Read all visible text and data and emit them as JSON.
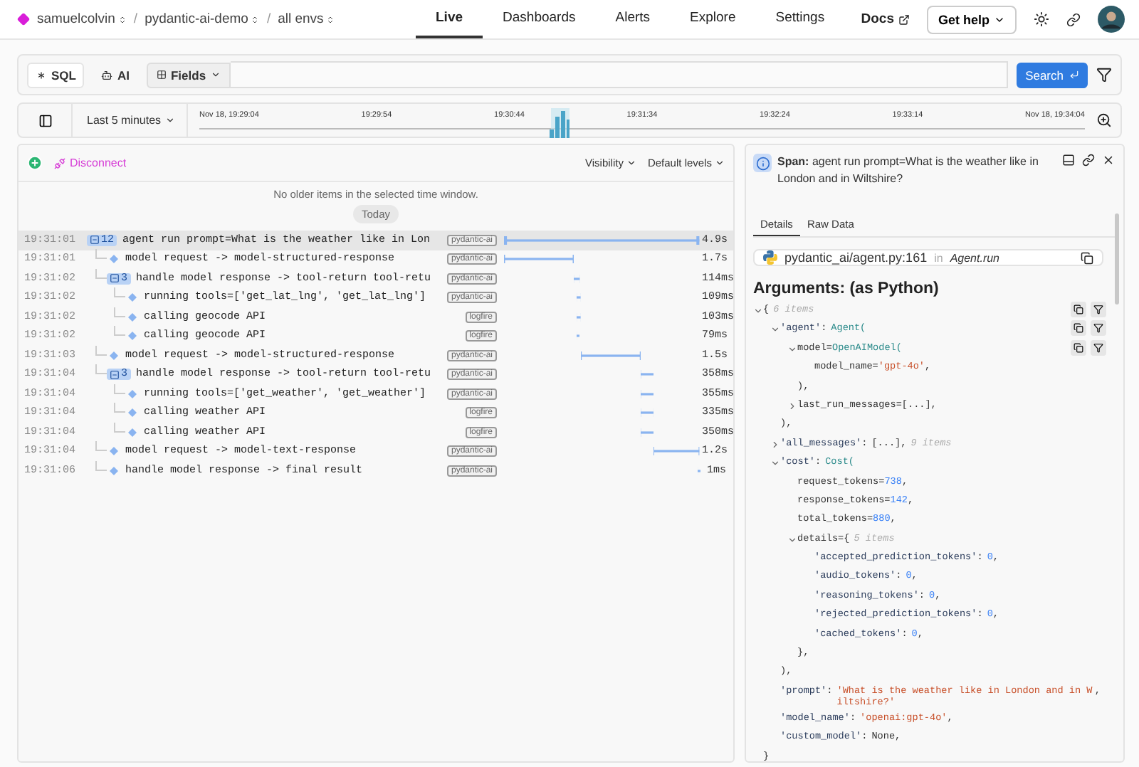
{
  "nav": {
    "breadcrumbs": [
      {
        "label": "samuelcolvin",
        "separator": "/"
      },
      {
        "label": "pydantic-ai-demo",
        "separator": "/"
      },
      {
        "label": "all envs"
      }
    ],
    "tabs": [
      {
        "label": "Live",
        "selected": true
      },
      {
        "label": "Dashboards",
        "selected": false
      },
      {
        "label": "Alerts",
        "selected": false
      },
      {
        "label": "Explore",
        "selected": false
      },
      {
        "label": "Settings",
        "selected": false
      }
    ],
    "docs": "Docs",
    "help": "Get help"
  },
  "query": {
    "modes": [
      {
        "label": "SQL",
        "kind": "sql",
        "selected": true
      },
      {
        "label": "AI",
        "kind": "ai",
        "selected": false
      }
    ],
    "fields": "Fields",
    "search": "Search"
  },
  "timeline": {
    "sidebar_open": false,
    "range": "Last 5 minutes",
    "ticks": [
      "Nov 18, 19:29:04",
      "19:29:54",
      "19:30:44",
      "19:31:34",
      "19:32:24",
      "19:33:14",
      "Nov 18, 19:34:04"
    ]
  },
  "live": {
    "disconnect": "Disconnect",
    "visibility": "Visibility",
    "levels": "Default levels",
    "notice": "No older items in the selected time window.",
    "day": "Today",
    "rows": [
      {
        "time": "19:31:01",
        "name": "agent run prompt=What is the weather like in Lon",
        "tag": "pydantic-ai",
        "duration": "4.9s",
        "count": "12",
        "expanded": true,
        "selected": true,
        "children": [
          {
            "time": "19:31:01",
            "name": "model request -> model-structured-response",
            "tag": "pydantic-ai",
            "duration": "1.7s",
            "selected": false
          },
          {
            "time": "19:31:02",
            "name": "handle model response -> tool-return tool-retu",
            "tag": "pydantic-ai",
            "duration": "114ms",
            "count": "3",
            "expanded": true,
            "selected": false,
            "children": [
              {
                "time": "19:31:02",
                "name": "running tools=['get_lat_lng', 'get_lat_lng']",
                "tag": "pydantic-ai",
                "duration": "109ms",
                "selected": false
              },
              {
                "time": "19:31:02",
                "name": "calling geocode API",
                "tag": "logfire",
                "duration": "103ms",
                "selected": false
              },
              {
                "time": "19:31:02",
                "name": "calling geocode API",
                "tag": "logfire",
                "duration": "79ms",
                "selected": false
              }
            ]
          },
          {
            "time": "19:31:03",
            "name": "model request -> model-structured-response",
            "tag": "pydantic-ai",
            "duration": "1.5s",
            "selected": false
          },
          {
            "time": "19:31:04",
            "name": "handle model response -> tool-return tool-retu",
            "tag": "pydantic-ai",
            "duration": "358ms",
            "count": "3",
            "expanded": true,
            "selected": false,
            "children": [
              {
                "time": "19:31:04",
                "name": "running tools=['get_weather', 'get_weather']",
                "tag": "pydantic-ai",
                "duration": "355ms",
                "selected": false
              },
              {
                "time": "19:31:04",
                "name": "calling weather API",
                "tag": "logfire",
                "duration": "335ms",
                "selected": false
              },
              {
                "time": "19:31:04",
                "name": "calling weather API",
                "tag": "logfire",
                "duration": "350ms",
                "selected": false
              }
            ]
          },
          {
            "time": "19:31:04",
            "name": "model request -> model-text-response",
            "tag": "pydantic-ai",
            "duration": "1.2s",
            "selected": false
          },
          {
            "time": "19:31:06",
            "name": "handle model response -> final result",
            "tag": "pydantic-ai",
            "duration": "1ms",
            "selected": false
          }
        ]
      }
    ]
  },
  "details": {
    "title": "**Span:** agent run prompt=What is the weather like in London and in Wiltshire?",
    "tabs": [
      {
        "label": "Details",
        "selected": true
      },
      {
        "label": "Raw Data",
        "selected": false
      }
    ],
    "source": {
      "path": "pydantic_ai/agent.py:161",
      "in": "in",
      "func": "Agent.run"
    },
    "heading": "Arguments: (as Python)",
    "code": [
      {
        "tokens": [
          {
            "kind": "plain",
            "text": "{"
          },
          {
            "kind": "note",
            "text": "6 items"
          }
        ],
        "expanded": true,
        "actions": true,
        "children": [
          {
            "tokens": [
              {
                "kind": "key",
                "text": "'agent'"
              },
              {
                "kind": "colon",
                "text": ":"
              },
              {
                "kind": "cls",
                "text": "Agent("
              }
            ],
            "expanded": true,
            "actions": true,
            "children": [
              {
                "tokens": [
                  {
                    "kind": "plain",
                    "text": "model="
                  },
                  {
                    "kind": "cls",
                    "text": "OpenAIModel("
                  }
                ],
                "expanded": true,
                "actions": true,
                "children": [
                  {
                    "tokens": [
                      {
                        "kind": "plain",
                        "text": "model_name="
                      },
                      {
                        "kind": "str",
                        "text": "'gpt-4o'"
                      },
                      {
                        "kind": "plain",
                        "text": ","
                      }
                    ]
                  }
                ]
              },
              {
                "tokens": [
                  {
                    "kind": "plain",
                    "text": "),"
                  }
                ]
              },
              {
                "tokens": [
                  {
                    "kind": "plain",
                    "text": "last_run_messages=[...],"
                  }
                ],
                "expanded": false
              }
            ]
          },
          {
            "tokens": [
              {
                "kind": "plain",
                "text": "),"
              }
            ]
          },
          {
            "tokens": [
              {
                "kind": "key",
                "text": "'all_messages'"
              },
              {
                "kind": "colon",
                "text": ":"
              },
              {
                "kind": "plain",
                "text": "[...],"
              },
              {
                "kind": "note",
                "text": "9 items"
              }
            ],
            "expanded": false
          },
          {
            "tokens": [
              {
                "kind": "key",
                "text": "'cost'"
              },
              {
                "kind": "colon",
                "text": ":"
              },
              {
                "kind": "cls",
                "text": "Cost("
              }
            ],
            "expanded": true,
            "children": [
              {
                "tokens": [
                  {
                    "kind": "plain",
                    "text": "request_tokens="
                  },
                  {
                    "kind": "num",
                    "text": "738"
                  },
                  {
                    "kind": "plain",
                    "text": ","
                  }
                ]
              },
              {
                "tokens": [
                  {
                    "kind": "plain",
                    "text": "response_tokens="
                  },
                  {
                    "kind": "num",
                    "text": "142"
                  },
                  {
                    "kind": "plain",
                    "text": ","
                  }
                ]
              },
              {
                "tokens": [
                  {
                    "kind": "plain",
                    "text": "total_tokens="
                  },
                  {
                    "kind": "num",
                    "text": "880"
                  },
                  {
                    "kind": "plain",
                    "text": ","
                  }
                ]
              },
              {
                "tokens": [
                  {
                    "kind": "plain",
                    "text": "details={"
                  },
                  {
                    "kind": "note",
                    "text": "5 items"
                  }
                ],
                "expanded": true,
                "children": [
                  {
                    "tokens": [
                      {
                        "kind": "key",
                        "text": "'accepted_prediction_tokens'"
                      },
                      {
                        "kind": "colon",
                        "text": ":"
                      },
                      {
                        "kind": "num",
                        "text": "0"
                      },
                      {
                        "kind": "plain",
                        "text": ","
                      }
                    ]
                  },
                  {
                    "tokens": [
                      {
                        "kind": "key",
                        "text": "'audio_tokens'"
                      },
                      {
                        "kind": "colon",
                        "text": ":"
                      },
                      {
                        "kind": "num",
                        "text": "0"
                      },
                      {
                        "kind": "plain",
                        "text": ","
                      }
                    ]
                  },
                  {
                    "tokens": [
                      {
                        "kind": "key",
                        "text": "'reasoning_tokens'"
                      },
                      {
                        "kind": "colon",
                        "text": ":"
                      },
                      {
                        "kind": "num",
                        "text": "0"
                      },
                      {
                        "kind": "plain",
                        "text": ","
                      }
                    ]
                  },
                  {
                    "tokens": [
                      {
                        "kind": "key",
                        "text": "'rejected_prediction_tokens'"
                      },
                      {
                        "kind": "colon",
                        "text": ":"
                      },
                      {
                        "kind": "num",
                        "text": "0"
                      },
                      {
                        "kind": "plain",
                        "text": ","
                      }
                    ]
                  },
                  {
                    "tokens": [
                      {
                        "kind": "key",
                        "text": "'cached_tokens'"
                      },
                      {
                        "kind": "colon",
                        "text": ":"
                      },
                      {
                        "kind": "num",
                        "text": "0"
                      },
                      {
                        "kind": "plain",
                        "text": ","
                      }
                    ]
                  }
                ]
              },
              {
                "tokens": [
                  {
                    "kind": "plain",
                    "text": "},"
                  }
                ]
              }
            ]
          },
          {
            "tokens": [
              {
                "kind": "plain",
                "text": "),"
              }
            ]
          },
          {
            "tokens": [
              {
                "kind": "key",
                "text": "'prompt'"
              },
              {
                "kind": "colon",
                "text": ":"
              },
              {
                "kind": "str",
                "text": "'What is the weather like in London and in Wiltshire?'"
              },
              {
                "kind": "plain",
                "text": ","
              }
            ]
          },
          {
            "tokens": [
              {
                "kind": "key",
                "text": "'model_name'"
              },
              {
                "kind": "colon",
                "text": ":"
              },
              {
                "kind": "str",
                "text": "'openai:gpt-4o'"
              },
              {
                "kind": "plain",
                "text": ","
              }
            ]
          },
          {
            "tokens": [
              {
                "kind": "key",
                "text": "'custom_model'"
              },
              {
                "kind": "colon",
                "text": ":"
              },
              {
                "kind": "plain",
                "text": "None,"
              }
            ]
          }
        ]
      },
      {
        "tokens": [
          {
            "kind": "plain",
            "text": "}"
          }
        ]
      }
    ]
  }
}
